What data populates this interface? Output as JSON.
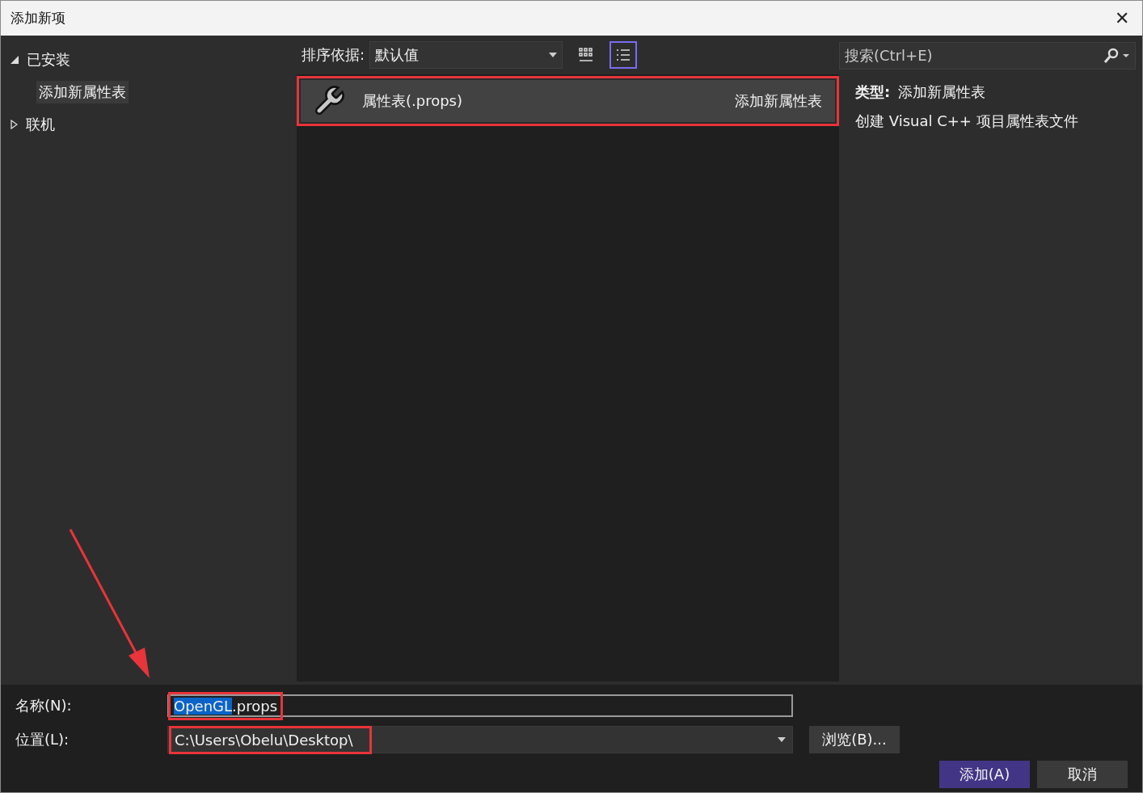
{
  "window": {
    "title": "添加新项",
    "close": "✕"
  },
  "sidebar": {
    "items": [
      {
        "label": "已安装",
        "expanded": true,
        "children": [
          {
            "label": "添加新属性表",
            "selected": true
          }
        ]
      },
      {
        "label": "联机",
        "expanded": false
      }
    ]
  },
  "toolbar": {
    "sort_label": "排序依据:",
    "sort_value": "默认值",
    "views": [
      {
        "kind": "grid",
        "selected": false
      },
      {
        "kind": "list",
        "selected": true
      }
    ]
  },
  "templates": [
    {
      "name": "属性表(.props)",
      "category": "添加新属性表",
      "selected": true,
      "highlighted": true
    }
  ],
  "search": {
    "placeholder": "搜索(Ctrl+E)"
  },
  "details": {
    "type_label": "类型:",
    "type_value": "添加新属性表",
    "description": "创建 Visual C++ 项目属性表文件"
  },
  "form": {
    "name_label": "名称(N):",
    "name_selected": "OpenGL",
    "name_rest": ".props",
    "name_highlighted": true,
    "location_label": "位置(L):",
    "location_value": "C:\\Users\\Obelu\\Desktop\\",
    "location_highlighted": true,
    "browse": "浏览(B)..."
  },
  "buttons": [
    {
      "label": "添加(A)",
      "kind": "primary"
    },
    {
      "label": "取消",
      "kind": "normal"
    }
  ]
}
